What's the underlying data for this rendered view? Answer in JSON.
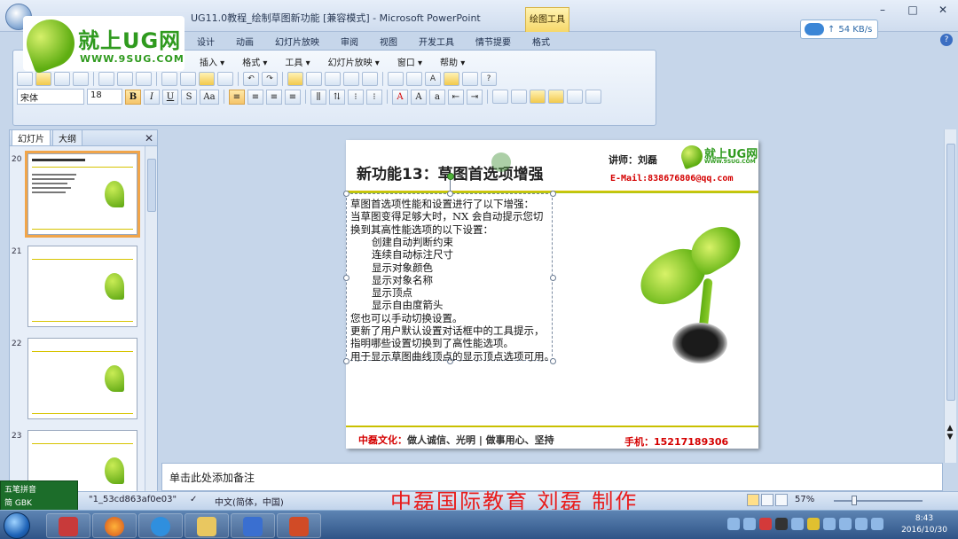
{
  "window": {
    "title": "UG11.0教程_绘制草图新功能 [兼容模式] - Microsoft PowerPoint",
    "contextual_tab_group": "绘图工具",
    "speed": "54 KB/s"
  },
  "ribbon_tabs": [
    "设计",
    "动画",
    "幻灯片放映",
    "审阅",
    "视图",
    "开发工具",
    "情节提要"
  ],
  "contextual_tab": "格式",
  "menu": [
    "插入",
    "格式",
    "工具",
    "幻灯片放映",
    "窗口",
    "帮助"
  ],
  "font": {
    "name": "宋体",
    "size": "18"
  },
  "format_buttons": [
    "B",
    "I",
    "U",
    "S",
    "Aa"
  ],
  "logo": {
    "brand": "就上UG网",
    "url": "WWW.9SUG.COM"
  },
  "slides_pane": {
    "tabs": [
      "幻灯片",
      "大纲"
    ],
    "thumbnails": [
      {
        "number": "20",
        "selected": true
      },
      {
        "number": "21",
        "selected": false
      },
      {
        "number": "22",
        "selected": false
      },
      {
        "number": "23",
        "selected": false
      }
    ]
  },
  "slide": {
    "title": "新功能13：草图首选项增强",
    "lecturer": "讲师：刘磊",
    "logo_text": "就上UG网",
    "logo_url": "WWW.9SUG.COM",
    "email": "E-Mail:838676806@qq.com",
    "body_lines": [
      {
        "text": "草图首选项性能和设置进行了以下增强：",
        "indent": false
      },
      {
        "text": "当草图变得足够大时，NX 会自动提示您切",
        "indent": false
      },
      {
        "text": "换到其高性能选项的以下设置：",
        "indent": false
      },
      {
        "text": "创建自动判断约束",
        "indent": true
      },
      {
        "text": "连续自动标注尺寸",
        "indent": true
      },
      {
        "text": "显示对象颜色",
        "indent": true
      },
      {
        "text": "显示对象名称",
        "indent": true
      },
      {
        "text": "显示顶点",
        "indent": true
      },
      {
        "text": "显示自由度箭头",
        "indent": true
      },
      {
        "text": "您也可以手动切换设置。",
        "indent": false
      },
      {
        "text": "更新了用户默认设置对话框中的工具提示，",
        "indent": false
      },
      {
        "text": "指明哪些设置切换到了高性能选项。",
        "indent": false
      },
      {
        "text": "用于显示草图曲线顶点的显示顶点选项可用。",
        "indent": false
      }
    ],
    "footer_brand": "中磊文化：",
    "footer_motto": "做人诚信、光明 | 做事用心、坚持",
    "footer_phone": "手机：15217189306"
  },
  "notes_placeholder": "单击此处添加备注",
  "status": {
    "slide_name": "\"1_53cd863af0e03\"",
    "language": "中文(简体，中国)",
    "zoom": "57%"
  },
  "watermark": "中磊国际教育 刘磊 制作",
  "ime": {
    "line1": "五笔拼音",
    "line2": "简 GBK"
  },
  "clock": {
    "time": "8:43",
    "date": "2016/10/30"
  }
}
